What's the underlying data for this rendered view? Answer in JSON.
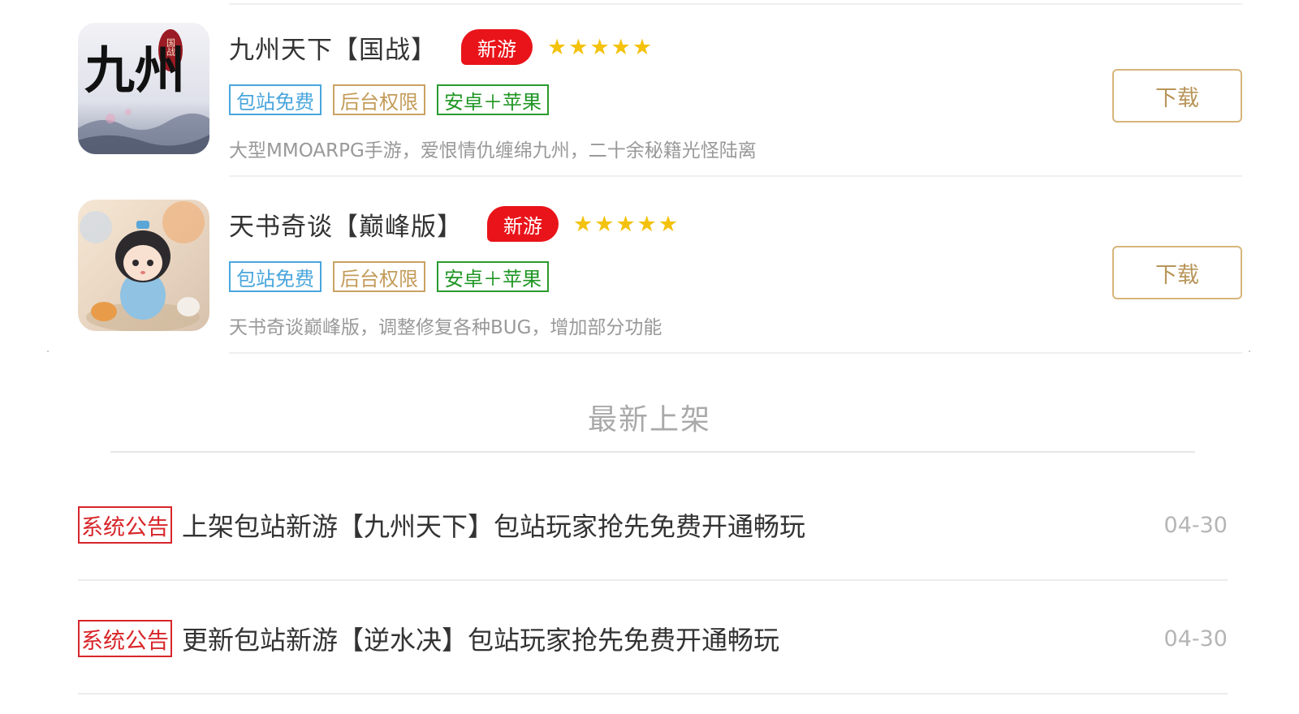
{
  "games": [
    {
      "title": "九州天下【国战】",
      "badge": "新游",
      "stars": "★★★★★",
      "tags": [
        "包站免费",
        "后台权限",
        "安卓＋苹果"
      ],
      "description": "大型MMOARPG手游，爱恨情仇缠绵九州，二十余秘籍光怪陆离",
      "icon_text_main": "九州",
      "icon_seal_text": "国战",
      "download_label": "下载"
    },
    {
      "title": "天书奇谈【巅峰版】",
      "badge": "新游",
      "stars": "★★★★★",
      "tags": [
        "包站免费",
        "后台权限",
        "安卓＋苹果"
      ],
      "description": "天书奇谈巅峰版，调整修复各种BUG，增加部分功能",
      "download_label": "下载"
    }
  ],
  "section": {
    "title": "最新上架"
  },
  "notices": [
    {
      "tag": "系统公告",
      "text": "上架包站新游【九州天下】包站玩家抢先免费开通畅玩",
      "date": "04-30"
    },
    {
      "tag": "系统公告",
      "text": "更新包站新游【逆水决】包站玩家抢先免费开通畅玩",
      "date": "04-30"
    }
  ],
  "colors": {
    "new_badge": "#e9141a",
    "star": "#f4c20d",
    "tag_blue": "#49a6dd",
    "tag_gold": "#c39b58",
    "tag_green": "#1f9624",
    "notice_red": "#d8262a",
    "download_border": "#d7b57a"
  }
}
